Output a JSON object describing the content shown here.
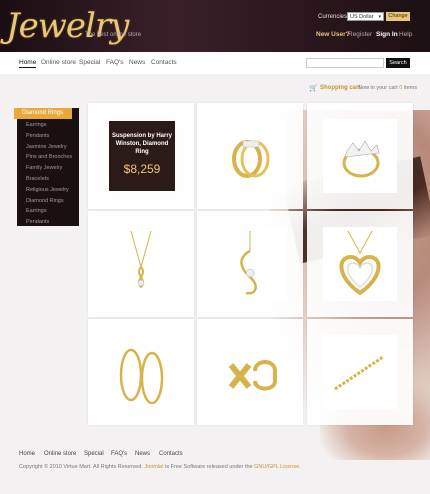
{
  "brand": {
    "logo": "Jewelry",
    "tagline": "The best online store"
  },
  "header": {
    "currency_label": "Currencies:",
    "currency_value": "US Dollar",
    "change_button": "Change",
    "new_user": "New User?",
    "register": "Register",
    "sign_in": "Sign In",
    "help": "Help"
  },
  "nav": {
    "items": [
      "Home",
      "Online store",
      "Special",
      "FAQ's",
      "News",
      "Contacts"
    ],
    "active": "Home"
  },
  "search": {
    "placeholder": "",
    "button": "Search"
  },
  "cart": {
    "title": "Shopping cart",
    "status_prefix": "Now in your cart",
    "count": "0",
    "status_suffix": "items"
  },
  "sidebar": {
    "header": "Diamond Rings",
    "items": [
      "Earrings",
      "Pendants",
      "Jasmine Jewelry",
      "Pins and Brooches",
      "Family Jewelry",
      "Bracelets",
      "Religious Jewelry",
      "Diamond Rings",
      "Earrings",
      "Pendants"
    ]
  },
  "promo": {
    "title": "Suspension by Harry Winston, Diamond Ring",
    "price": "$8,259"
  },
  "products": [
    {
      "icon": "promo"
    },
    {
      "icon": "diamond-ring-icon"
    },
    {
      "icon": "three-stone-ring-icon"
    },
    {
      "icon": "pendant-necklace-icon"
    },
    {
      "icon": "swirl-pendant-icon"
    },
    {
      "icon": "heart-pendant-icon"
    },
    {
      "icon": "hoop-earrings-icon"
    },
    {
      "icon": "x-huggie-earrings-icon"
    },
    {
      "icon": "tennis-bracelet-icon"
    }
  ],
  "footer": {
    "links": [
      "Home",
      "Online store",
      "Special",
      "FAQ's",
      "News",
      "Contacts"
    ],
    "copyright_a": "Copyright © 2010 Virtue Mart. All Rights Reserved.",
    "copyright_b": "Joomla!",
    "copyright_c": "is Free Software released under the",
    "copyright_d": "GNU/GPL License."
  },
  "colors": {
    "accent": "#e8a83a",
    "gold": "#c9922e",
    "header_bg": "#2b171d"
  }
}
